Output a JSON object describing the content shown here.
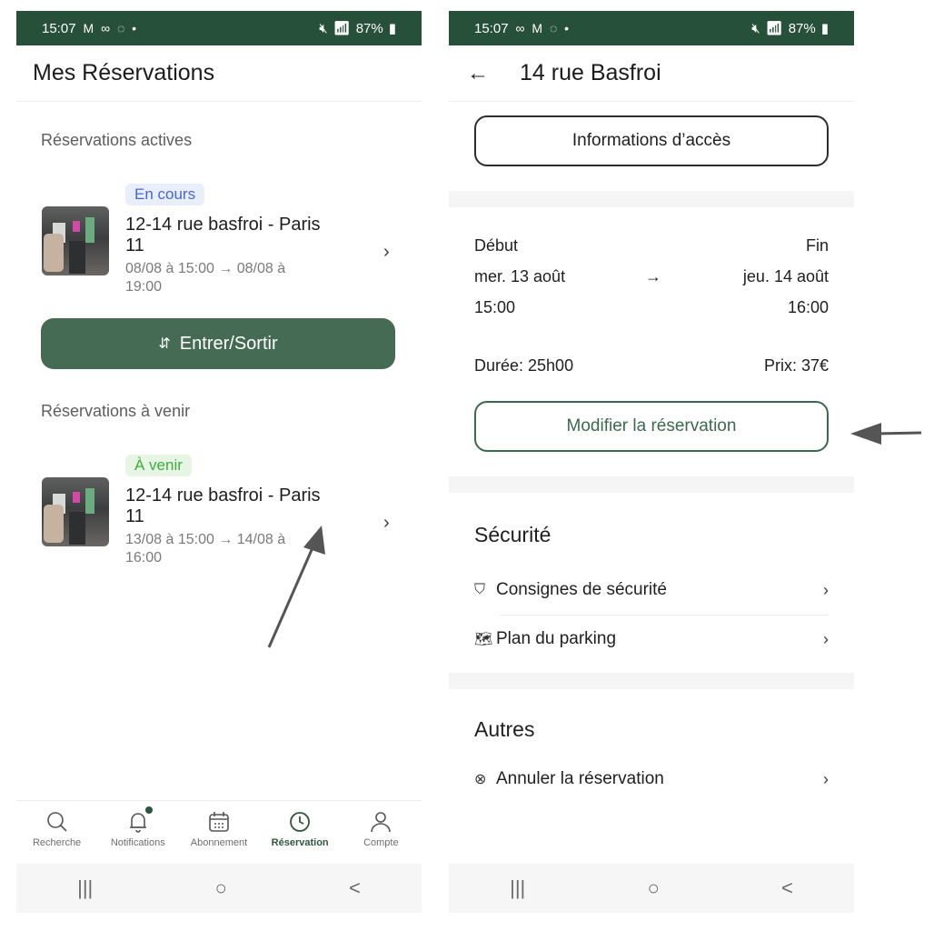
{
  "status_bar": {
    "left_time": "15:07",
    "left_icons": "M ∞ ◌ •",
    "right_time": "15:07",
    "right_icons": "∞ M ◌ •",
    "battery": "87%"
  },
  "left_screen": {
    "title": "Mes Réservations",
    "active_section": "Réservations actives",
    "active_card": {
      "badge": "En cours",
      "title_line1": "12-14 rue basfroi - Paris",
      "title_line2": "11",
      "dates_line1": "08/08 à 15:00 → 08/08 à",
      "dates_line2": "19:00"
    },
    "enter_exit_button": "Entrer/Sortir",
    "enter_exit_icon": "⇵",
    "upcoming_section": "Réservations à venir",
    "upcoming_card": {
      "badge": "À venir",
      "title_line1": "12-14 rue basfroi - Paris",
      "title_line2": "11",
      "dates_line1": "13/08 à 15:00 → 14/08 à",
      "dates_line2": "16:00"
    },
    "tabs": [
      {
        "label": "Recherche",
        "icon": "search-icon"
      },
      {
        "label": "Notifications",
        "icon": "bell-icon"
      },
      {
        "label": "Abonnement",
        "icon": "calendar-icon"
      },
      {
        "label": "Réservation",
        "icon": "clock-icon",
        "active": true
      },
      {
        "label": "Compte",
        "icon": "user-icon"
      }
    ]
  },
  "right_screen": {
    "back": "←",
    "title": "14 rue Basfroi",
    "access_button": "Informations d’accès",
    "start_label": "Début",
    "end_label": "Fin",
    "start_date": "mer. 13 août",
    "end_date": "jeu. 14 août",
    "arrow": "→",
    "start_time": "15:00",
    "end_time": "16:00",
    "duration": "Durée: 25h00",
    "price": "Prix: 37€",
    "modify_button": "Modifier la réservation",
    "security_title": "Sécurité",
    "security_items": [
      "Consignes de sécurité",
      "Plan du parking"
    ],
    "others_title": "Autres",
    "others_items": [
      "Annuler la réservation"
    ]
  },
  "nav": {
    "recents": "|||",
    "home": "○",
    "back": "<"
  },
  "colors": {
    "status_bar": "#27503a",
    "primary": "#466b55",
    "accent": "#3a6a4e"
  }
}
